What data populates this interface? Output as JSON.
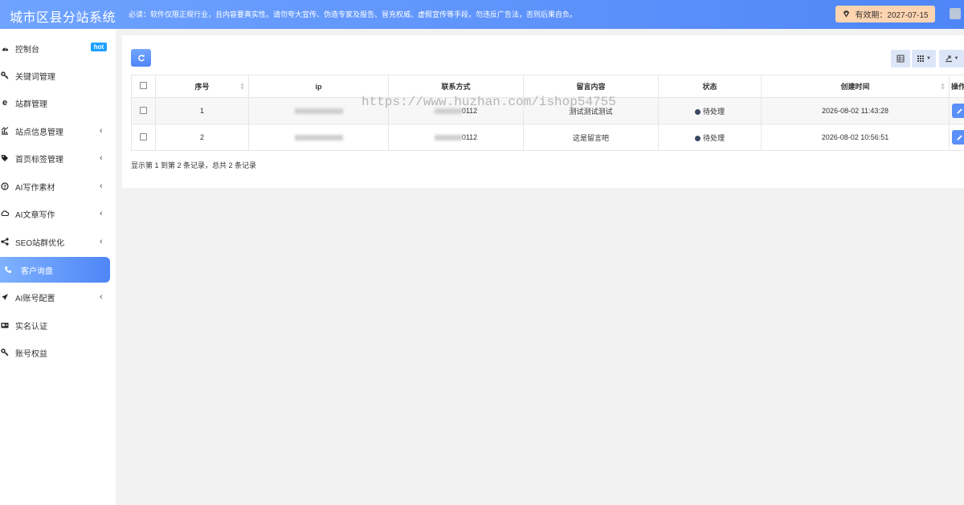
{
  "header": {
    "title": "城市区县分站系统",
    "notice": "必读：软件仅限正规行业，且内容要真实性。请勿夸大宣传、伪造专家及报告、冒充权威、虚假宣传等手段，勿违反广告法，否则后果自负。",
    "validity_label": "有效期：2027-07-15"
  },
  "sidebar": {
    "items": [
      {
        "label": "控制台",
        "icon": "dashboard-icon",
        "badge": "hot"
      },
      {
        "label": "关键词管理",
        "icon": "key-icon"
      },
      {
        "label": "站群管理",
        "icon": "ie-icon"
      },
      {
        "label": "站点信息管理",
        "icon": "chart-icon",
        "expandable": true
      },
      {
        "label": "首页标签管理",
        "icon": "tag-icon",
        "expandable": true
      },
      {
        "label": "AI写作素材",
        "icon": "question-icon",
        "expandable": true
      },
      {
        "label": "AI文章写作",
        "icon": "cloud-icon",
        "expandable": true
      },
      {
        "label": "SEO站群优化",
        "icon": "share-icon",
        "expandable": true
      },
      {
        "label": "客户询盘",
        "icon": "phone-icon",
        "active": true
      },
      {
        "label": "AI账号配置",
        "icon": "plane-icon",
        "expandable": true
      },
      {
        "label": "实名认证",
        "icon": "id-card-icon"
      },
      {
        "label": "账号权益",
        "icon": "key-icon"
      }
    ]
  },
  "table": {
    "columns": [
      "序号",
      "ip",
      "联系方式",
      "留言内容",
      "状态",
      "创建时间",
      "操作"
    ],
    "rows": [
      {
        "index": "1",
        "contact_suffix": "0112",
        "message": "测试测试测试",
        "status": "待处理",
        "created": "2026-08-02 11:43:28"
      },
      {
        "index": "2",
        "contact_suffix": "0112",
        "message": "这是留言吧",
        "status": "待处理",
        "created": "2026-08-02 10:56:51"
      }
    ]
  },
  "pagination": {
    "summary": "显示第 1 到第 2 条记录，总共 2 条记录"
  },
  "watermark": "https://www.huzhan.com/ishop54755",
  "colors": {
    "header_blue": "#4f86f7",
    "hot_badge": "#1e9fff",
    "validity_bg": "#ffd4b0",
    "status_dot": "#3b4863"
  }
}
